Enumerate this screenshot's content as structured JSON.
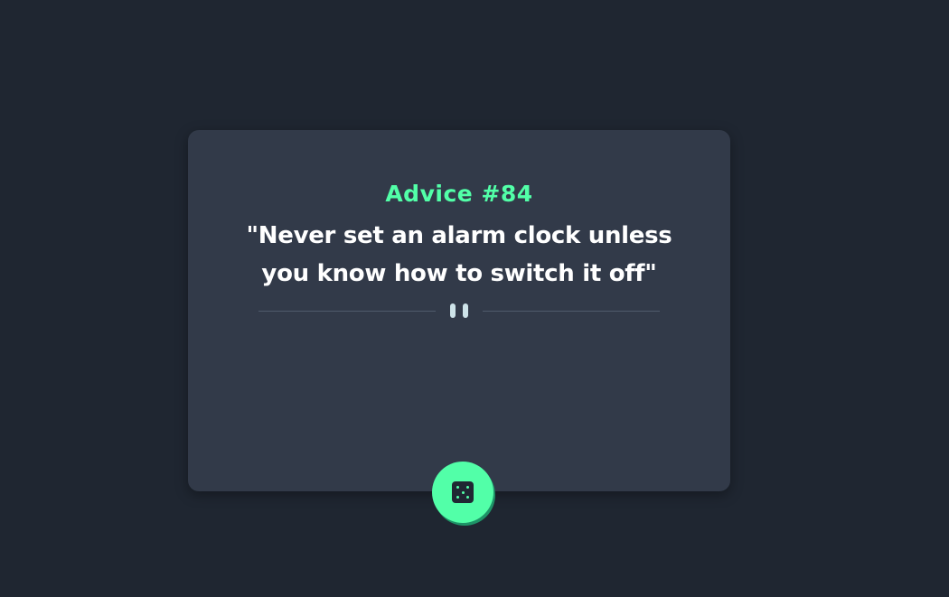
{
  "card": {
    "advice_id_label": "Advice #84",
    "advice_text": "\"Never set an alarm clock unless you know how to switch it off\""
  },
  "divider": {
    "icon": "pause-icon"
  },
  "dice_button": {
    "icon": "dice-icon"
  },
  "colors": {
    "background": "#1f2631",
    "card": "#323a49",
    "accent": "#52ffa8",
    "text": "#ffffff",
    "divider_line": "#4f5b6b"
  }
}
